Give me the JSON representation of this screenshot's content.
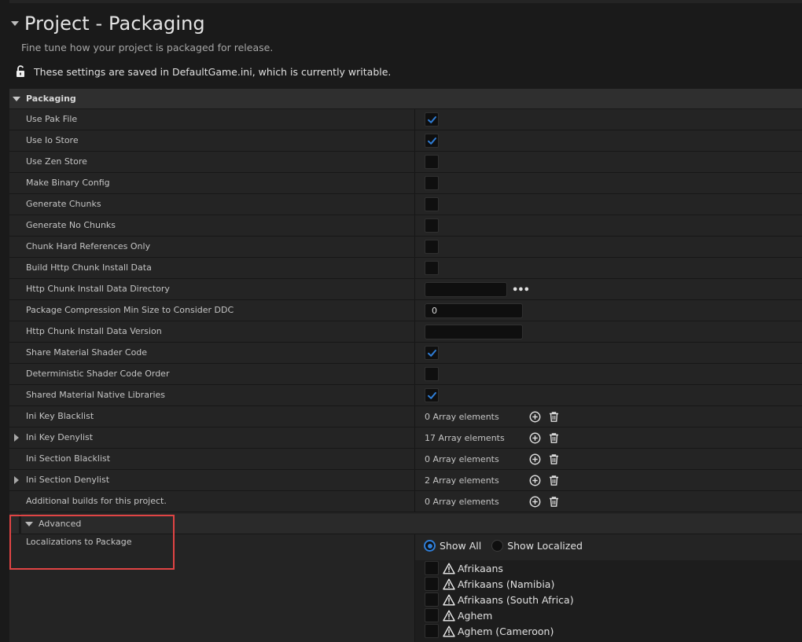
{
  "header": {
    "title": "Project - Packaging",
    "subtitle": "Fine tune how your project is packaged for release.",
    "saved_notice": "These settings are saved in DefaultGame.ini, which is currently writable."
  },
  "section": {
    "title": "Packaging"
  },
  "rows": [
    {
      "label": "Use Pak File",
      "type": "checkbox",
      "checked": true
    },
    {
      "label": "Use Io Store",
      "type": "checkbox",
      "checked": true
    },
    {
      "label": "Use Zen Store",
      "type": "checkbox",
      "checked": false
    },
    {
      "label": "Make Binary Config",
      "type": "checkbox",
      "checked": false
    },
    {
      "label": "Generate Chunks",
      "type": "checkbox",
      "checked": false
    },
    {
      "label": "Generate No Chunks",
      "type": "checkbox",
      "checked": false
    },
    {
      "label": "Chunk Hard References Only",
      "type": "checkbox",
      "checked": false
    },
    {
      "label": "Build Http Chunk Install Data",
      "type": "checkbox",
      "checked": false
    },
    {
      "label": "Http Chunk Install Data Directory",
      "type": "directory",
      "value": "",
      "browse_label": "•••"
    },
    {
      "label": "Package Compression Min Size to Consider DDC",
      "type": "text",
      "value": "0"
    },
    {
      "label": "Http Chunk Install Data Version",
      "type": "text",
      "value": ""
    },
    {
      "label": "Share Material Shader Code",
      "type": "checkbox",
      "checked": true
    },
    {
      "label": "Deterministic Shader Code Order",
      "type": "checkbox",
      "checked": false
    },
    {
      "label": "Shared Material Native Libraries",
      "type": "checkbox",
      "checked": true
    },
    {
      "label": "Ini Key Blacklist",
      "type": "array",
      "value": "0 Array elements",
      "expandable": false
    },
    {
      "label": "Ini Key Denylist",
      "type": "array",
      "value": "17 Array elements",
      "expandable": true
    },
    {
      "label": "Ini Section Blacklist",
      "type": "array",
      "value": "0 Array elements",
      "expandable": false
    },
    {
      "label": "Ini Section Denylist",
      "type": "array",
      "value": "2 Array elements",
      "expandable": true
    },
    {
      "label": "Additional builds for this project.",
      "type": "array",
      "value": "0 Array elements",
      "expandable": false
    }
  ],
  "advanced": {
    "label": "Advanced",
    "localizations_label": "Localizations to Package",
    "filter": {
      "show_all": "Show All",
      "show_localized": "Show Localized",
      "selected": "show_all"
    },
    "languages": [
      {
        "name": "Afrikaans",
        "checked": false
      },
      {
        "name": "Afrikaans (Namibia)",
        "checked": false
      },
      {
        "name": "Afrikaans (South Africa)",
        "checked": false
      },
      {
        "name": "Aghem",
        "checked": false
      },
      {
        "name": "Aghem (Cameroon)",
        "checked": false
      }
    ]
  },
  "colors": {
    "accent": "#2f7ed8",
    "highlight_box": "#e04444"
  },
  "icons": {
    "lock": "unlocked-lock-icon",
    "add": "add-element-icon",
    "delete": "trash-icon",
    "warning": "warning-icon"
  }
}
